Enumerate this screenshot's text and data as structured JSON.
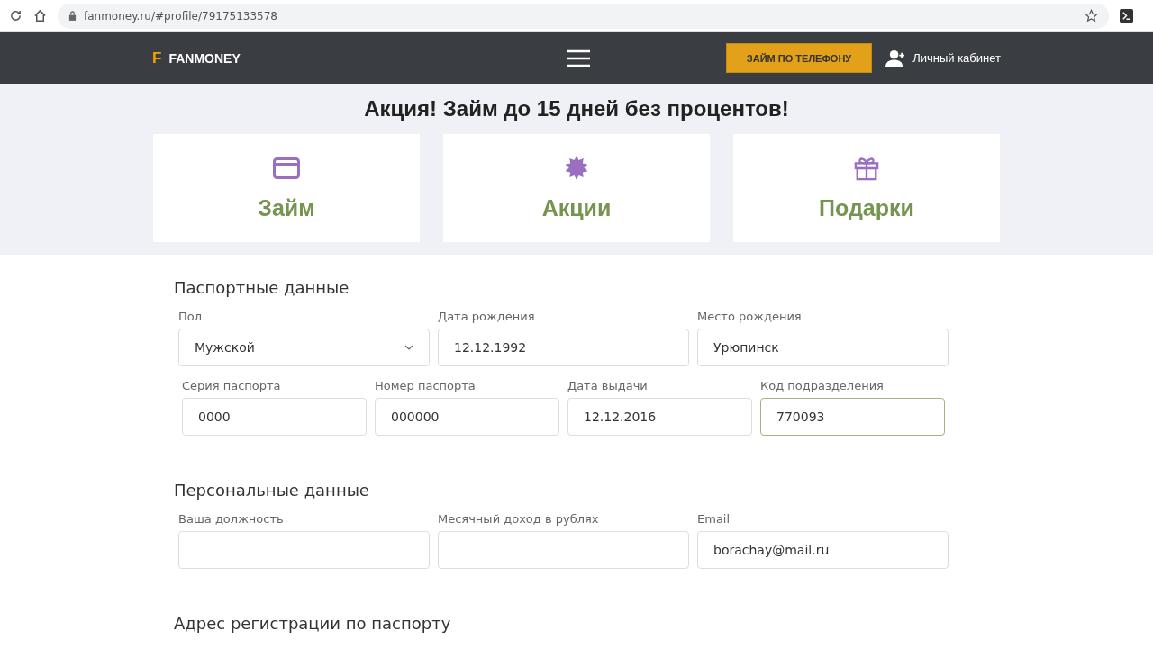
{
  "browser": {
    "url": "fanmoney.ru/#profile/79175133578"
  },
  "header": {
    "logo_letter": "F",
    "logo_text": "FANMONEY",
    "cta_button": "ЗАЙМ ПО ТЕЛЕФОНУ",
    "account_link": "Личный кабинет"
  },
  "promo": {
    "title": "Акция! Займ до 15 дней без процентов!",
    "cards": [
      {
        "kind": "card",
        "label": "Займ"
      },
      {
        "kind": "badge",
        "label": "Акции"
      },
      {
        "kind": "gift",
        "label": "Подарки"
      }
    ]
  },
  "sections": [
    {
      "title": "Паспортные данные",
      "rows": [
        [
          {
            "label": "Пол",
            "kind": "select",
            "value": "Мужской",
            "focused": false
          },
          {
            "label": "Дата рождения",
            "kind": "text",
            "value": "12.12.1992",
            "focused": false
          },
          {
            "label": "Место рождения",
            "kind": "text",
            "value": "Урюпинск",
            "focused": false
          }
        ],
        [
          {
            "label": "Серия паспорта",
            "kind": "text",
            "value": "0000",
            "focused": false
          },
          {
            "label": "Номер паспорта",
            "kind": "text",
            "value": "000000",
            "focused": false
          },
          {
            "label": "Дата выдачи",
            "kind": "text",
            "value": "12.12.2016",
            "focused": false
          },
          {
            "label": "Код подразделения",
            "kind": "text",
            "value": "770093",
            "focused": true
          }
        ]
      ]
    },
    {
      "title": "Персональные данные",
      "rows": [
        [
          {
            "label": "Ваша должность",
            "kind": "text",
            "focused": false
          },
          {
            "label": "Месячный доход в рублях",
            "kind": "text",
            "focused": false
          },
          {
            "label": "Email",
            "kind": "text",
            "value": "borachay@mail.ru",
            "focused": false
          }
        ]
      ]
    },
    {
      "title": "Адрес регистрации по паспорту"
    }
  ]
}
